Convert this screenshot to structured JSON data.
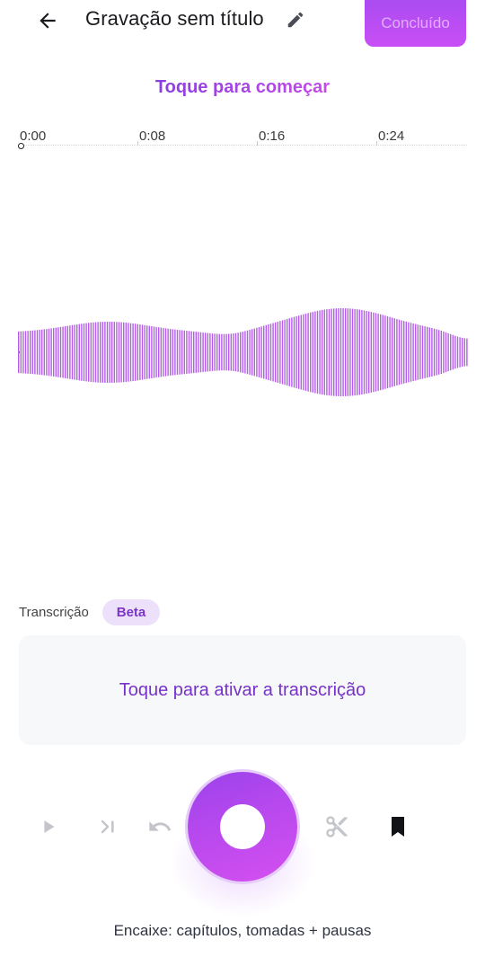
{
  "header": {
    "title": "Gravação sem título",
    "done_label": "Concluído",
    "back_icon": "arrow-left-icon",
    "edit_icon": "pencil-icon"
  },
  "prompt": {
    "tap_to_start": "Toque para começar"
  },
  "timeline": {
    "ticks": [
      "0:00",
      "0:08",
      "0:16",
      "0:24"
    ]
  },
  "transcription": {
    "label": "Transcrição",
    "badge": "Beta",
    "activate_text": "Toque para ativar a transcrição"
  },
  "controls": {
    "play_icon": "play-icon",
    "skip_icon": "skip-to-end-icon",
    "undo_icon": "undo-icon",
    "record_icon": "record-icon",
    "cut_icon": "scissors-icon",
    "bookmark_icon": "bookmark-icon"
  },
  "footer": {
    "hint": "Encaixe: capítulos, tomadas + pausas"
  },
  "colors": {
    "accent": "#a64cf0",
    "accent_light": "#ece0fb",
    "waveform": "#b25ee6",
    "transcription_text": "#7732c9"
  }
}
